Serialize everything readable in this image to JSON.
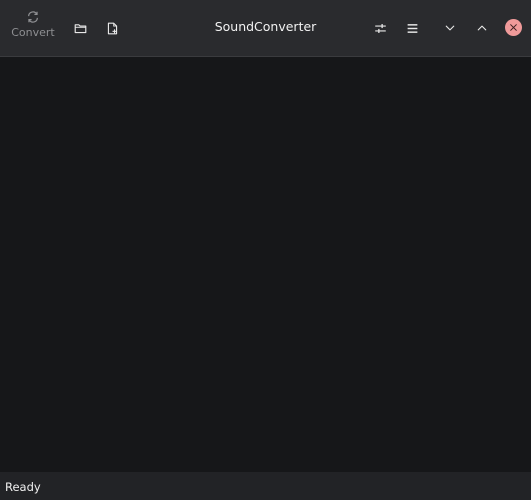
{
  "app": {
    "title": "SoundConverter"
  },
  "toolbar": {
    "convert_label": "Convert",
    "icons": {
      "convert": "refresh-icon",
      "add_folder": "folder-icon",
      "add_file": "add-file-icon",
      "preferences": "sliders-icon",
      "menu": "hamburger-menu-icon",
      "minimize": "chevron-down-icon",
      "maximize": "chevron-up-icon",
      "close": "close-icon"
    }
  },
  "status": {
    "text": "Ready"
  },
  "colors": {
    "headerbar": "#2a2b2e",
    "content": "#161719",
    "statusbar": "#222326",
    "close_button": "#ef9a9a",
    "disabled_text": "#8e8f92"
  }
}
